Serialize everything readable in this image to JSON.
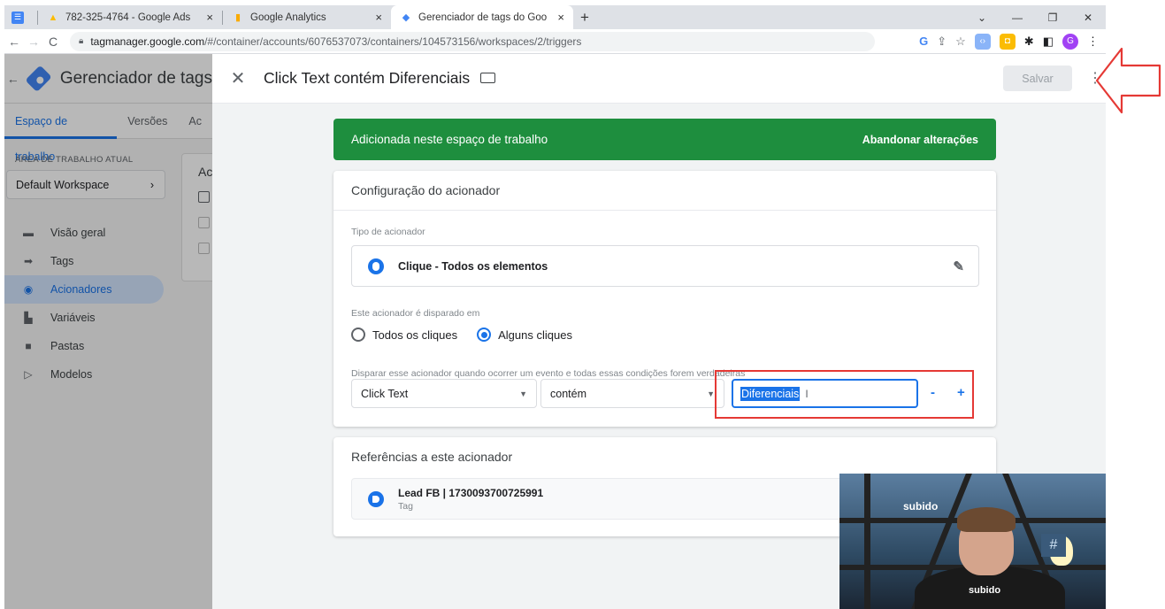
{
  "browser": {
    "tabs": [
      {
        "title": "782-325-4764 - Google Ads",
        "close": "×"
      },
      {
        "title": "Google Analytics",
        "close": "×"
      },
      {
        "title": "Gerenciador de tags do Google",
        "close": "×"
      }
    ],
    "new_tab": "+",
    "url_host": "tagmanager.google.com",
    "url_path": "/#/container/accounts/6076537073/containers/104573156/workspaces/2/triggers",
    "profile_initial": "G"
  },
  "app": {
    "title": "Gerenciador de tags",
    "tabs": [
      "Espaço de trabalho",
      "Versões",
      "Ac"
    ],
    "workspace_label": "ÁREA DE TRABALHO ATUAL",
    "workspace_name": "Default Workspace",
    "nav": [
      "Visão geral",
      "Tags",
      "Acionadores",
      "Variáveis",
      "Pastas",
      "Modelos"
    ],
    "card_header": "Ac"
  },
  "editor": {
    "title": "Click Text contém Diferenciais",
    "save_label": "Salvar",
    "banner_text": "Adicionada neste espaço de trabalho",
    "banner_action": "Abandonar alterações",
    "config_title": "Configuração do acionador",
    "trigger_type_label": "Tipo de acionador",
    "trigger_type": "Clique - Todos os elementos",
    "fires_on_label": "Este acionador é disparado em",
    "radio_all": "Todos os cliques",
    "radio_some": "Alguns cliques",
    "condition_label": "Disparar esse acionador quando ocorrer um evento e todas essas condições forem verdadeiras",
    "condition_variable": "Click Text",
    "condition_operator": "contém",
    "condition_value": "Diferenciais",
    "remove_label": "-",
    "add_label": "+",
    "references_title": "Referências a este acionador",
    "reference_name": "Lead FB | 1730093700725991",
    "reference_type": "Tag"
  },
  "webcam": {
    "brand_top": "subido",
    "brand_shirt": "subido"
  },
  "colors": {
    "accent": "#1a73e8",
    "banner_green": "#1e8e3e",
    "annotation_red": "#e53935"
  }
}
